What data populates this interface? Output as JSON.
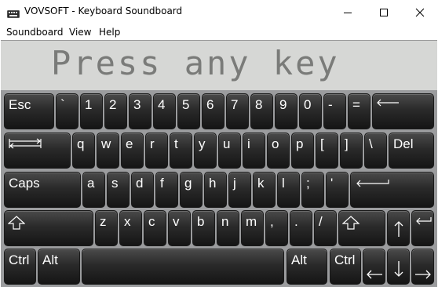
{
  "window": {
    "title": "VOVSOFT - Keyboard Soundboard"
  },
  "menu": {
    "items": [
      "Soundboard",
      "View",
      "Help"
    ]
  },
  "display": {
    "text": "Press any key"
  },
  "keyboard": {
    "row1": [
      "Esc",
      "`",
      "1",
      "2",
      "3",
      "4",
      "5",
      "6",
      "7",
      "8",
      "9",
      "0",
      "-",
      "="
    ],
    "row2": [
      "q",
      "w",
      "e",
      "r",
      "t",
      "y",
      "u",
      "i",
      "o",
      "p",
      "[",
      "]",
      "\\",
      "Del"
    ],
    "row3": [
      "Caps",
      "a",
      "s",
      "d",
      "f",
      "g",
      "h",
      "j",
      "k",
      "l",
      ";",
      "'"
    ],
    "row4": [
      "z",
      "x",
      "c",
      "v",
      "b",
      "n",
      "m",
      ",",
      ".",
      "/"
    ],
    "row5": {
      "ctrl_left": "Ctrl",
      "alt_left": "Alt",
      "alt_right": "Alt",
      "ctrl_right": "Ctrl"
    }
  },
  "colors": {
    "keyboard_bg": "#9b9c9e",
    "key_face": "#2a2a2a",
    "lcd_bg": "#d6d7d5"
  }
}
